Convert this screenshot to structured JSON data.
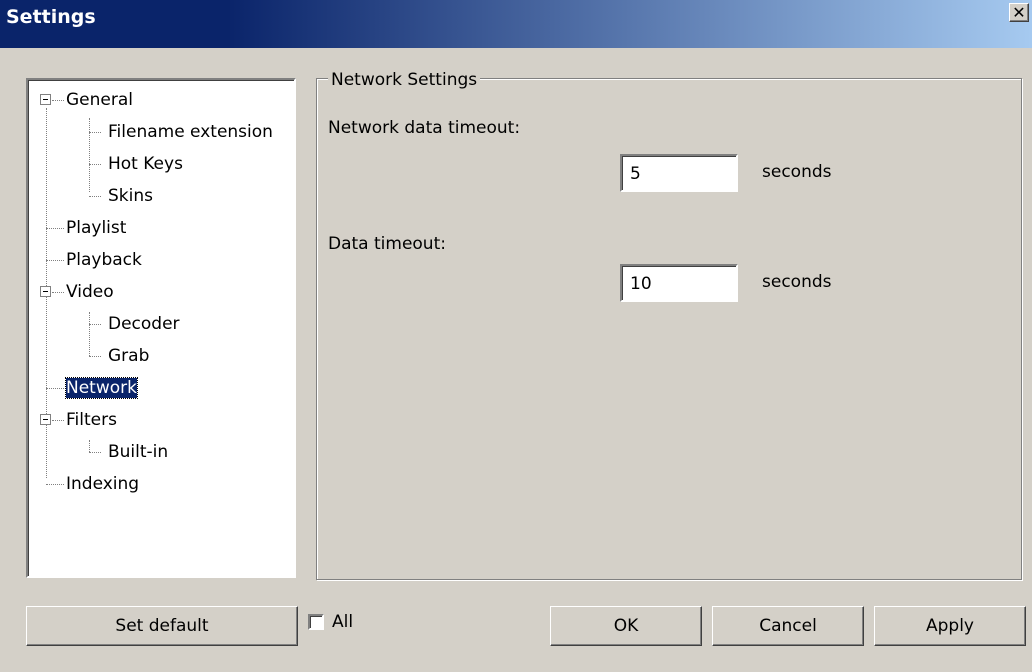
{
  "window": {
    "title": "Settings"
  },
  "tree": {
    "items": [
      {
        "label": "General"
      },
      {
        "label": "Filename extension"
      },
      {
        "label": "Hot Keys"
      },
      {
        "label": "Skins"
      },
      {
        "label": "Playlist"
      },
      {
        "label": "Playback"
      },
      {
        "label": "Video"
      },
      {
        "label": "Decoder"
      },
      {
        "label": "Grab"
      },
      {
        "label": "Network"
      },
      {
        "label": "Filters"
      },
      {
        "label": "Built-in"
      },
      {
        "label": "Indexing"
      }
    ],
    "selected": "Network"
  },
  "network": {
    "group_title": "Network Settings",
    "network_timeout_label": "Network data timeout:",
    "network_timeout_value": "5",
    "data_timeout_label": "Data timeout:",
    "data_timeout_value": "10",
    "unit": "seconds"
  },
  "footer": {
    "set_default": "Set default",
    "all_label": "All",
    "ok": "OK",
    "cancel": "Cancel",
    "apply": "Apply"
  }
}
